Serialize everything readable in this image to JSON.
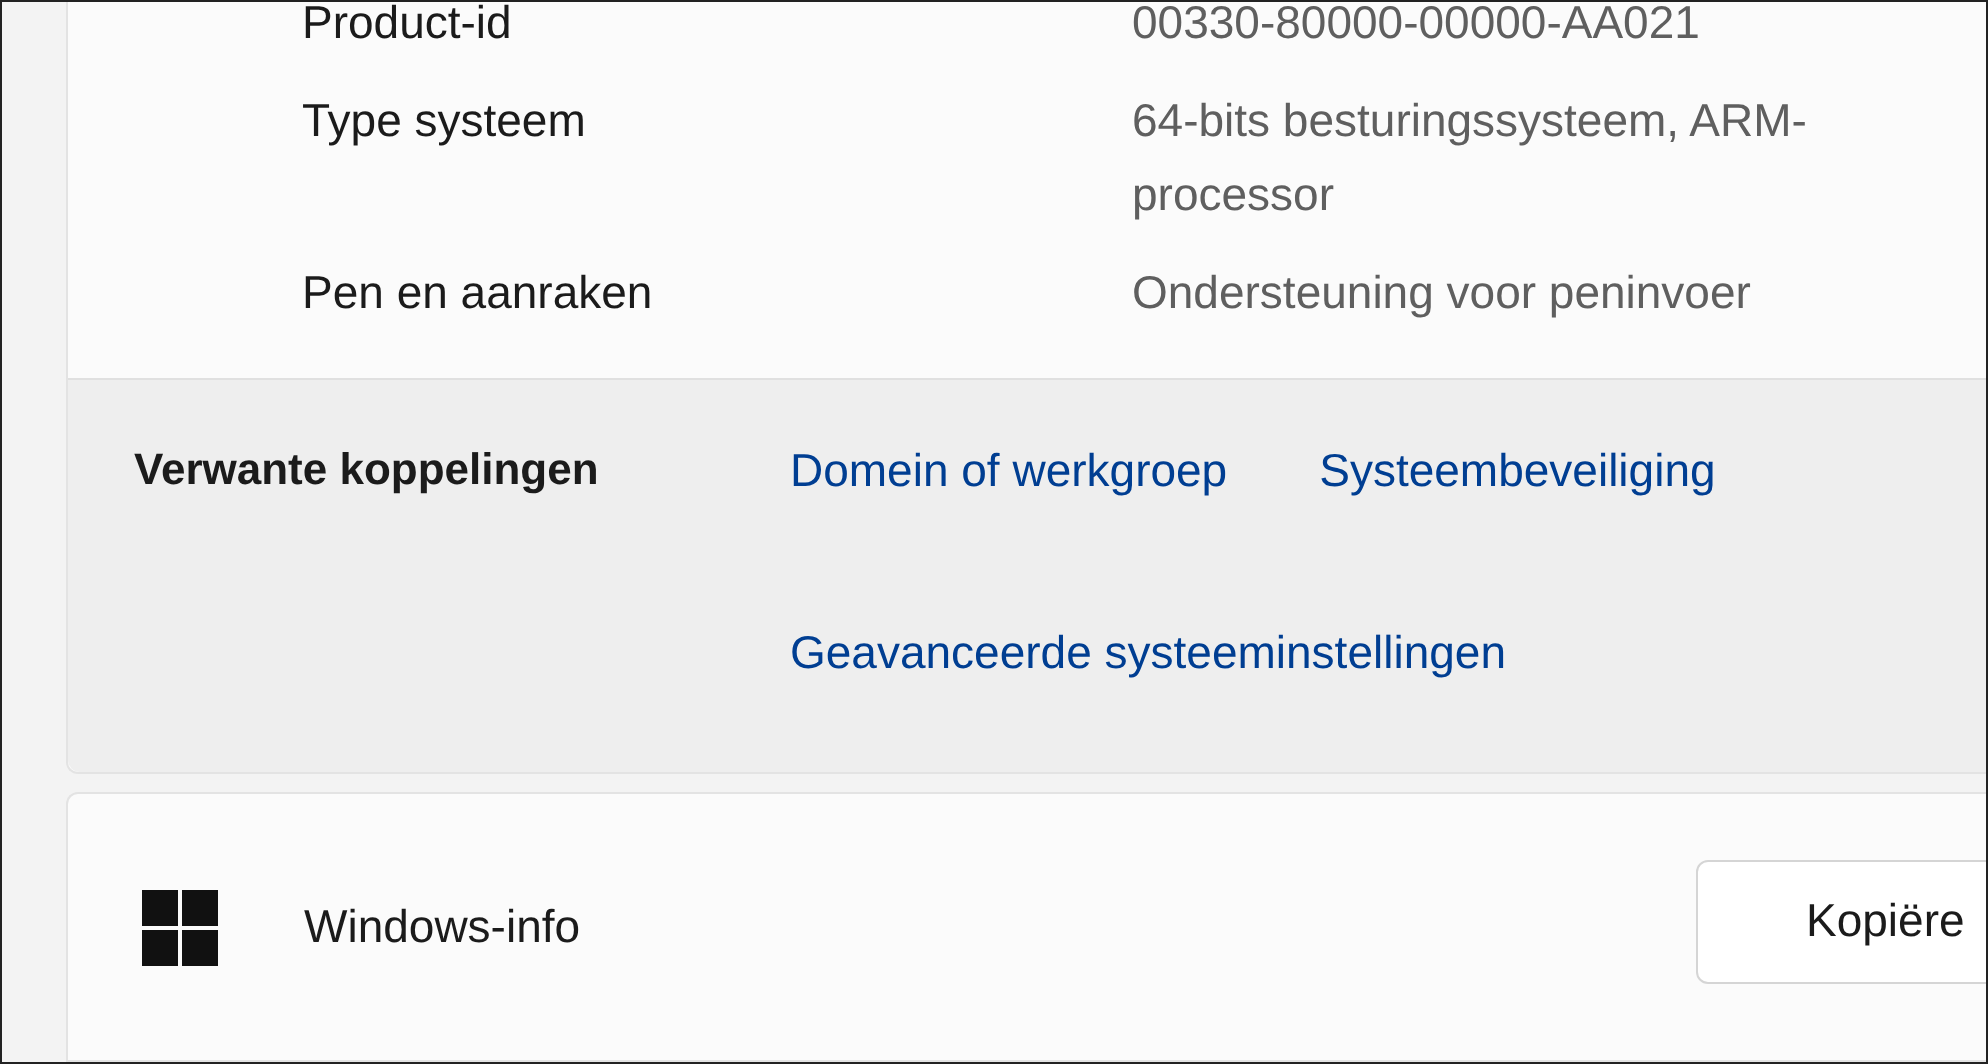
{
  "specs": [
    {
      "label": "Product-id",
      "value": "00330-80000-00000-AA021"
    },
    {
      "label": "Type systeem",
      "value": "64-bits besturingssysteem, ARM-processor"
    },
    {
      "label": "Pen en aanraken",
      "value": "Ondersteuning voor peninvoer"
    }
  ],
  "related": {
    "title": "Verwante koppelingen",
    "links": [
      "Domein of werkgroep",
      "Systeembeveiliging",
      "Geavanceerde systeeminstellingen"
    ]
  },
  "windows_card": {
    "title": "Windows-info",
    "button": "Kopiëre"
  }
}
